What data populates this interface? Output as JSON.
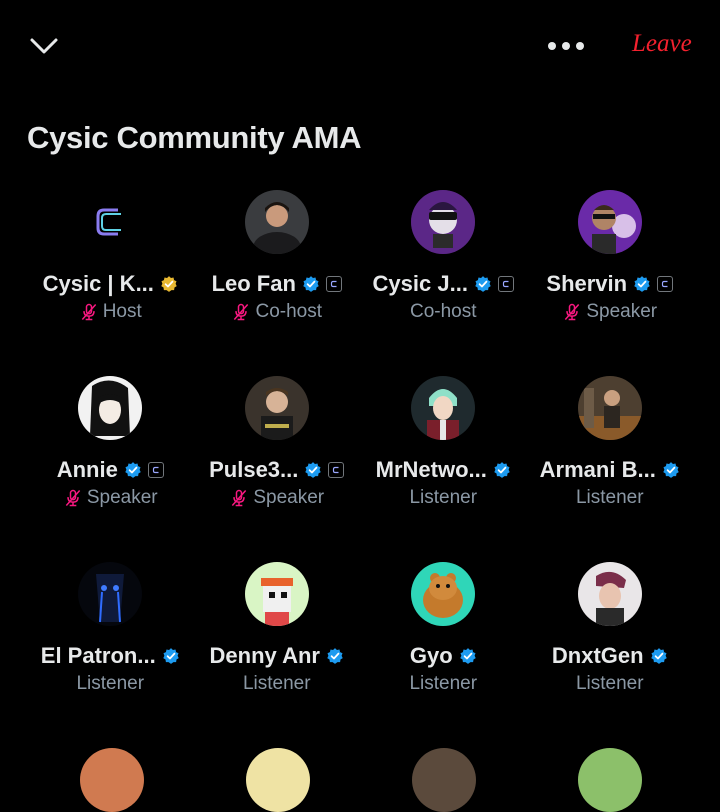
{
  "header": {
    "leave_label": "Leave",
    "collapse_icon": "chevron-down-icon",
    "more_icon": "more-horizontal-icon"
  },
  "space": {
    "title": "Cysic Community AMA"
  },
  "colors": {
    "verified_blue": "#1d9bf0",
    "verified_gold": "#e8b831",
    "muted_mic": "#f91880",
    "leave_red": "#f4212e"
  },
  "participants": [
    {
      "name": "Cysic | K...",
      "role": "Host",
      "muted": true,
      "badge": "gold",
      "affiliate": false
    },
    {
      "name": "Leo Fan",
      "role": "Co-host",
      "muted": true,
      "badge": "blue",
      "affiliate": true
    },
    {
      "name": "Cysic J...",
      "role": "Co-host",
      "muted": false,
      "badge": "blue",
      "affiliate": true
    },
    {
      "name": "Shervin",
      "role": "Speaker",
      "muted": true,
      "badge": "blue",
      "affiliate": true
    },
    {
      "name": "Annie",
      "role": "Speaker",
      "muted": true,
      "badge": "blue",
      "affiliate": true
    },
    {
      "name": "Pulse3...",
      "role": "Speaker",
      "muted": true,
      "badge": "blue",
      "affiliate": true
    },
    {
      "name": "MrNetwo...",
      "role": "Listener",
      "muted": false,
      "badge": "blue",
      "affiliate": false
    },
    {
      "name": "Armani B...",
      "role": "Listener",
      "muted": false,
      "badge": "blue",
      "affiliate": false
    },
    {
      "name": "El Patron...",
      "role": "Listener",
      "muted": false,
      "badge": "blue",
      "affiliate": false
    },
    {
      "name": "Denny Anr",
      "role": "Listener",
      "muted": false,
      "badge": "blue",
      "affiliate": false
    },
    {
      "name": "Gyo",
      "role": "Listener",
      "muted": false,
      "badge": "blue",
      "affiliate": false
    },
    {
      "name": "DnxtGen",
      "role": "Listener",
      "muted": false,
      "badge": "blue",
      "affiliate": false
    }
  ]
}
